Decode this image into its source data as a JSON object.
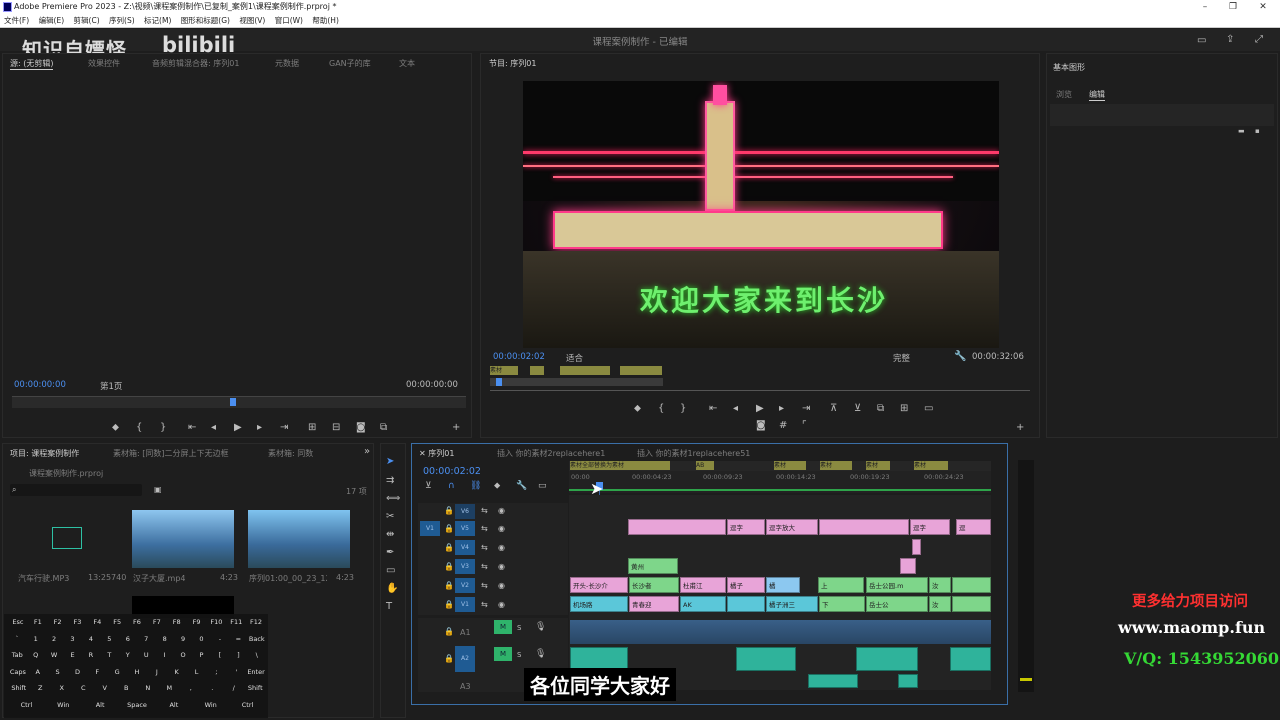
{
  "window": {
    "title": "Adobe Premiere Pro 2023 - Z:\\视频\\课程案例制作\\已复制_案例1\\课程案例制作.prproj *",
    "workspace_title": "课程案例制作 - 已编辑"
  },
  "menu": [
    "文件(F)",
    "编辑(E)",
    "剪辑(C)",
    "序列(S)",
    "标记(M)",
    "图形和标题(G)",
    "视图(V)",
    "窗口(W)",
    "帮助(H)"
  ],
  "watermark": {
    "text": "知识自嫖怪",
    "logo": "bilibili"
  },
  "source_panel": {
    "tabs": [
      "源: (无剪辑)",
      "效果控件",
      "音频剪辑混合器: 序列01",
      "元数据",
      "GAN子的库",
      "文本"
    ],
    "timecode_left": "00:00:00:00",
    "page": "第1页",
    "timecode_right": "00:00:00:00"
  },
  "program_panel": {
    "title": "节目: 序列01",
    "timecode": "00:00:02:02",
    "fit": "适合",
    "quality": "完整",
    "duration": "00:00:32:06",
    "marker_label": "素材",
    "video_text": "欢迎大家来到长沙"
  },
  "essential_graphics": {
    "title": "基本图形",
    "tabs": [
      "浏览",
      "编辑"
    ]
  },
  "project_panel": {
    "tabs": [
      "项目: 课程案例制作",
      "素材箱: [同数]二分屏上下无边框",
      "素材箱: 同数"
    ],
    "filename": "课程案例制作.prproj",
    "count": "17 项",
    "items": [
      {
        "name": "汽车行驶.MP3",
        "duration": "13:25740"
      },
      {
        "name": "汉子大厦.mp4",
        "duration": "4:23"
      },
      {
        "name": "序列01:00_00_23_12...",
        "duration": "4:23"
      }
    ]
  },
  "timeline": {
    "tabs": [
      "序列01",
      "插入 你的素材2replacehere1",
      "插入 你的素材1replacehere51"
    ],
    "timecode": "00:00:02:02",
    "ruler": [
      "00:00",
      "00:00:04:23",
      "00:00:09:23",
      "00:00:14:23",
      "00:00:19:23",
      "00:00:24:23"
    ],
    "video_tracks": [
      "V6",
      "V5",
      "V4",
      "V3",
      "V2",
      "V1"
    ],
    "audio_tracks": [
      "A1",
      "A2",
      "A3"
    ],
    "v5_clips": [
      "逗字",
      "逗字放大",
      "逗字",
      "逗"
    ],
    "v3_clips": [
      "黄州"
    ],
    "v2_clips": [
      "开头-长沙介",
      "长沙者",
      "杜甫江",
      "橘子",
      "橘",
      "上",
      "岳士公园.m",
      "汝"
    ],
    "v1_clips": [
      "机场路",
      "青春迎",
      "AK",
      "橘子洲三",
      "下",
      "岳士公",
      "汝"
    ],
    "marker_labels": [
      "素材全部替换为素材",
      "AB",
      "素材",
      "素材",
      "素材",
      "素材"
    ]
  },
  "keyboard": {
    "row1": [
      "Esc",
      "F1",
      "F2",
      "F3",
      "F4",
      "F5",
      "F6",
      "F7",
      "F8",
      "F9",
      "F10",
      "F11",
      "F12"
    ],
    "row2": [
      "`",
      "1",
      "2",
      "3",
      "4",
      "5",
      "6",
      "7",
      "8",
      "9",
      "0",
      "-",
      "=",
      "Back"
    ],
    "row3": [
      "Tab",
      "Q",
      "W",
      "E",
      "R",
      "T",
      "Y",
      "U",
      "I",
      "O",
      "P",
      "[",
      "]",
      "\\"
    ],
    "row4": [
      "Caps",
      "A",
      "S",
      "D",
      "F",
      "G",
      "H",
      "J",
      "K",
      "L",
      ";",
      "'",
      "Enter"
    ],
    "row5": [
      "Shift",
      "Z",
      "X",
      "C",
      "V",
      "B",
      "N",
      "M",
      ",",
      ".",
      "/",
      "Shift"
    ],
    "row6": [
      "Ctrl",
      "Win",
      "Alt",
      "Space",
      "Alt",
      "Win",
      "Ctrl"
    ]
  },
  "subtitle": "各位同学大家好",
  "ad": {
    "line1": "更多给力项目访问",
    "line2": "www.maomp.fun",
    "line3": "V/Q:  1543952060"
  },
  "colors": {
    "accent_blue": "#4b8ff0",
    "clip_pink": "#e8a4d8",
    "clip_green": "#7ed68a",
    "clip_cyan": "#5bc7d9",
    "audio_teal": "#2fb39b"
  }
}
